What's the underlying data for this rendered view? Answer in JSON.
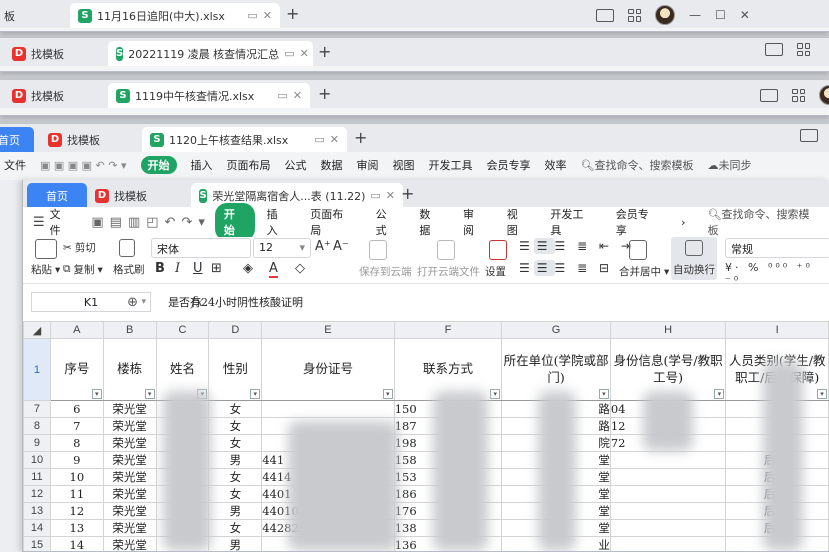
{
  "windows": [
    {
      "tabs": [
        {
          "label": "板"
        },
        {
          "label": "11月16日追阳(中大).xlsx",
          "active": true
        }
      ]
    },
    {
      "tabs": [
        {
          "label": "找模板"
        },
        {
          "label": "20221119 凌晨 核查情况汇总",
          "active": true
        }
      ]
    },
    {
      "tabs": [
        {
          "label": "找模板"
        },
        {
          "label": "1119中午核查情况.xlsx",
          "active": true
        }
      ]
    },
    {
      "tabs": [
        {
          "label": "首页"
        },
        {
          "label": "找模板"
        },
        {
          "label": "1120上午核查结果.xlsx",
          "active": true
        }
      ],
      "menu": [
        "文件",
        "开始",
        "插入",
        "页面布局",
        "公式",
        "数据",
        "审阅",
        "视图",
        "开发工具",
        "会员专享",
        "效率"
      ],
      "search": "查找命令、搜索模板",
      "sync": "未同步"
    }
  ],
  "main": {
    "tabs": {
      "home": "首页",
      "template": "找模板",
      "doc": "荣光堂隔离宿舍人...表 (11.22)"
    },
    "menu": {
      "file": "文件",
      "start": "开始",
      "insert": "插入",
      "layout": "页面布局",
      "formula": "公式",
      "data": "数据",
      "review": "审阅",
      "view": "视图",
      "dev": "开发工具",
      "vip": "会员专享",
      "more": "›",
      "search": "查找命令、搜索模板"
    },
    "ribbon": {
      "format_painter": "格式刷",
      "paste": "粘贴",
      "cut": "剪切",
      "copy": "复制",
      "font": "宋体",
      "size": "12",
      "save_cloud": "保存到云端",
      "open_cloud": "打开云端文件",
      "settings": "设置",
      "merge": "合并居中",
      "wrap": "自动换行",
      "numformat": "常规"
    },
    "namebox": "K1",
    "formula": "是否有24小时阴性核酸证明",
    "columns": [
      "A",
      "B",
      "C",
      "D",
      "E",
      "F",
      "G",
      "H",
      "I"
    ],
    "header_row": {
      "row": "1",
      "cells": [
        "序号",
        "楼栋",
        "姓名",
        "性别",
        "身份证号",
        "联系方式",
        "所在单位(学院或部门)",
        "身份信息(学号/教职工号)",
        "人员类别(学生/教职工/后勤保障)"
      ]
    },
    "rows": [
      {
        "r": "7",
        "seq": "6",
        "bld": "荣光堂",
        "sex": "女",
        "id": "",
        "phone": "150",
        "unit": "路",
        "ident": "04",
        "cat": ""
      },
      {
        "r": "8",
        "seq": "7",
        "bld": "荣光堂",
        "sex": "女",
        "id": "",
        "phone": "187",
        "unit": "路",
        "ident": "12",
        "cat": ""
      },
      {
        "r": "9",
        "seq": "8",
        "bld": "荣光堂",
        "sex": "女",
        "id": "",
        "phone": "198",
        "unit": "院",
        "ident": "72",
        "cat": ""
      },
      {
        "r": "10",
        "seq": "9",
        "bld": "荣光堂",
        "sex": "男",
        "id": "441",
        "phone": "158",
        "unit": "堂",
        "ident": "",
        "cat": "后 员"
      },
      {
        "r": "11",
        "seq": "10",
        "bld": "荣光堂",
        "sex": "女",
        "id": "4414",
        "phone": "153",
        "unit": "堂",
        "ident": "",
        "cat": "后 员"
      },
      {
        "r": "12",
        "seq": "11",
        "bld": "荣光堂",
        "sex": "女",
        "id": "4401",
        "phone": "186",
        "unit": "堂",
        "ident": "",
        "cat": "后 员"
      },
      {
        "r": "13",
        "seq": "12",
        "bld": "荣光堂",
        "sex": "男",
        "id": "44010",
        "phone": "176",
        "unit": "堂",
        "ident": "",
        "cat": "后 员"
      },
      {
        "r": "14",
        "seq": "13",
        "bld": "荣光堂",
        "sex": "女",
        "id": "44282",
        "phone": "138",
        "unit": "堂",
        "ident": "",
        "cat": "后 员"
      },
      {
        "r": "15",
        "seq": "14",
        "bld": "荣光堂",
        "sex": "男",
        "id": "",
        "phone": "136",
        "unit": "业",
        "ident": "",
        "cat": ""
      }
    ]
  }
}
